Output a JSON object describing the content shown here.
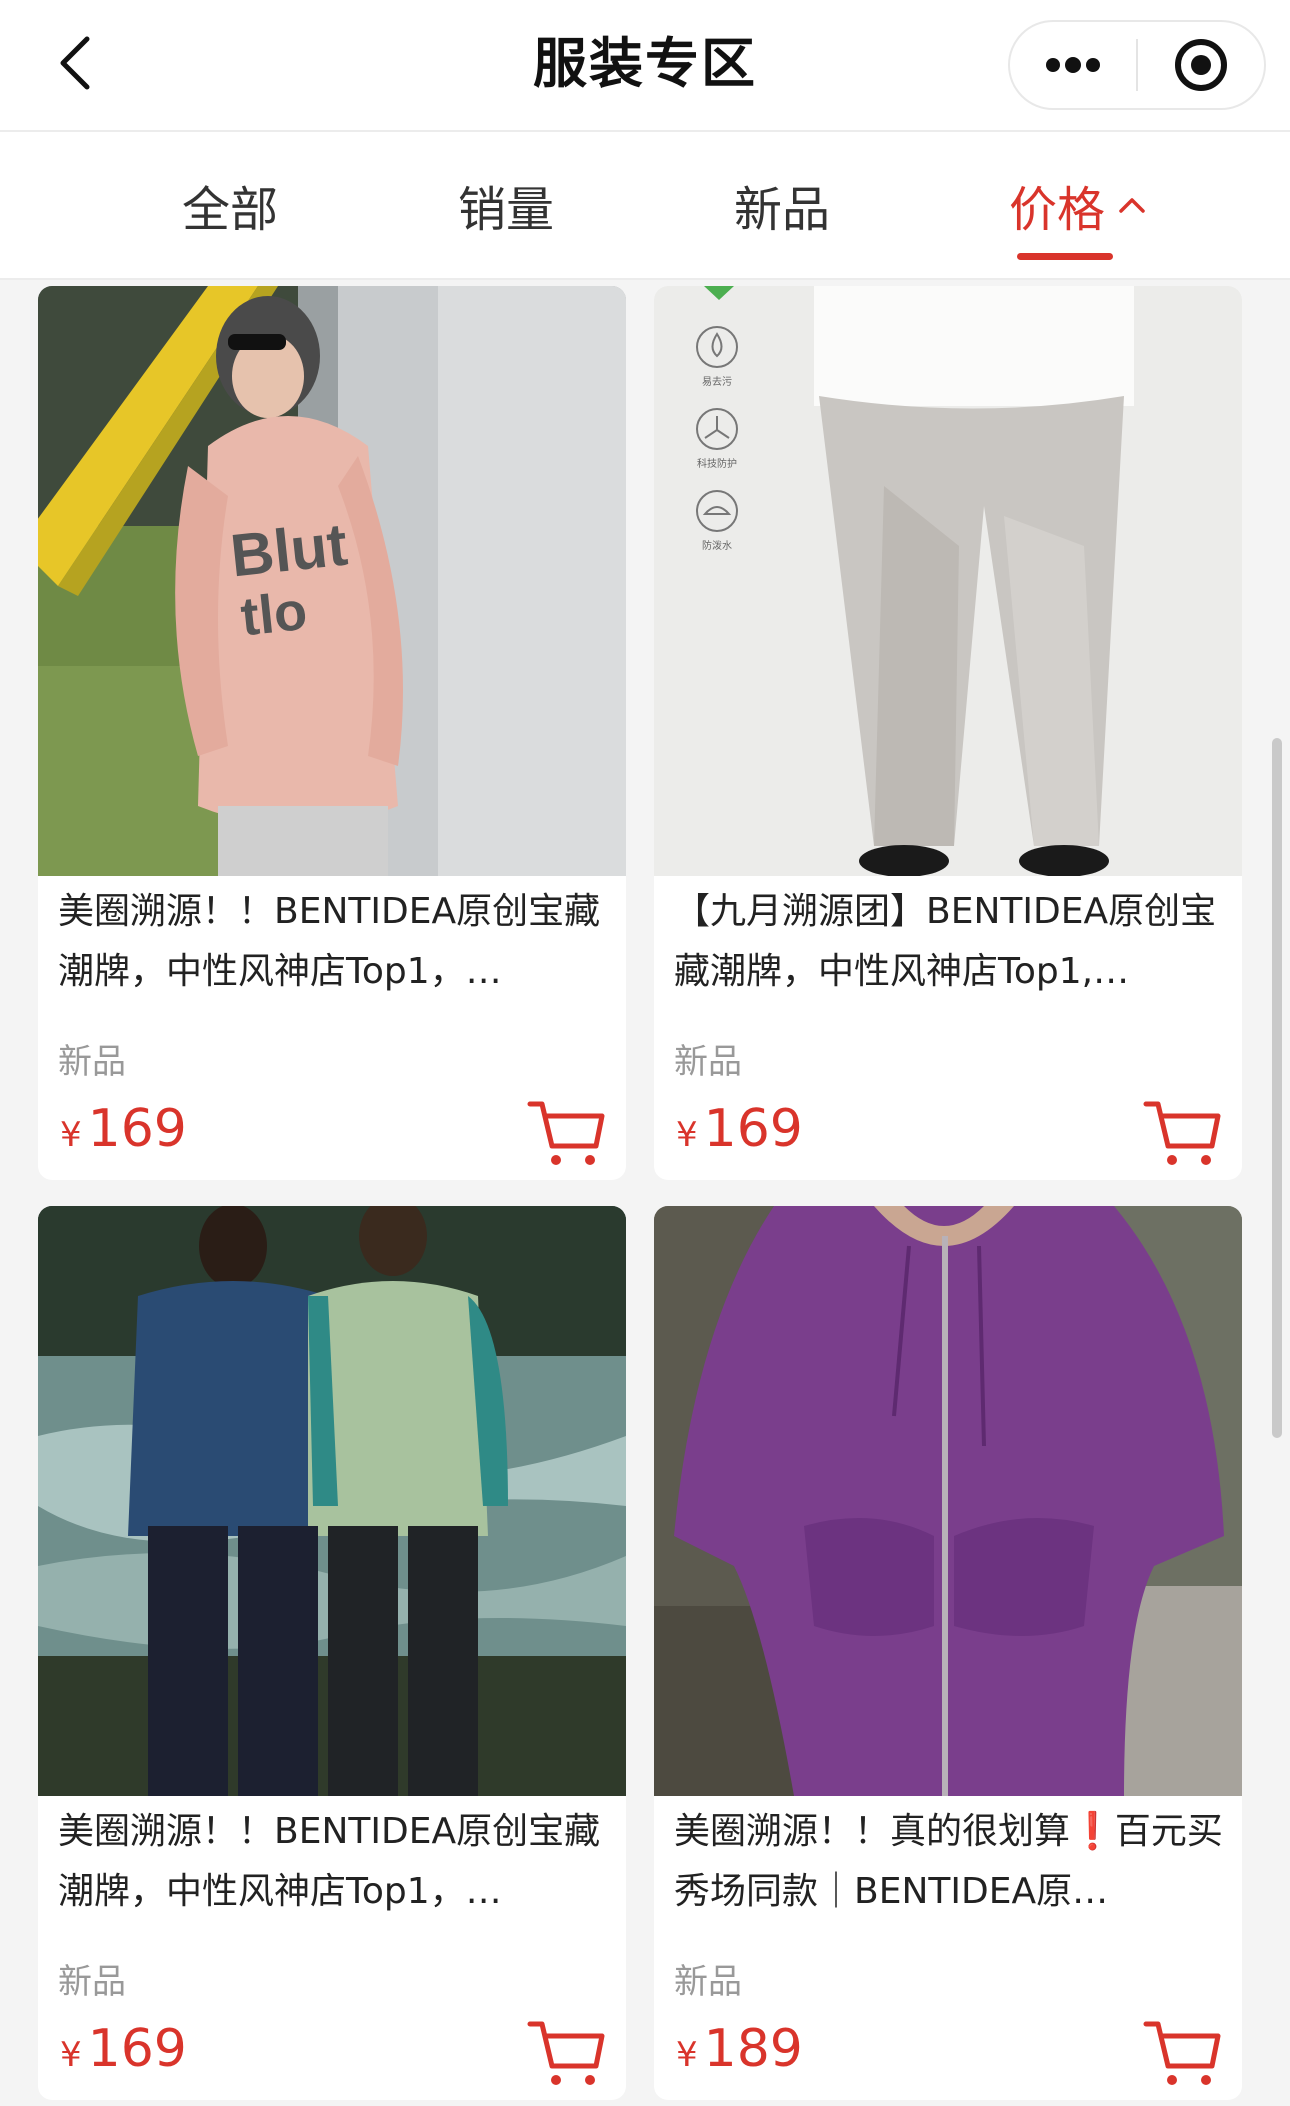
{
  "nav": {
    "title": "服装专区",
    "back_icon": "chevron-left-icon",
    "more_icon": "more-dots-icon",
    "close_icon": "target-circle-icon"
  },
  "tabs": [
    {
      "label": "全部",
      "active": false
    },
    {
      "label": "销量",
      "active": false
    },
    {
      "label": "新品",
      "active": false
    },
    {
      "label": "价格",
      "active": true,
      "icon": "chevron-up-icon"
    }
  ],
  "products": [
    {
      "name": "美圈溯源！！BENTIDEA原创宝藏潮牌，中性风神店Top1，…",
      "tag": "新品",
      "currency": "¥",
      "price": "169",
      "image": "pink-hoodie-photo",
      "cart_icon": "cart-icon"
    },
    {
      "name": "【九月溯源团】BENTIDEA原创宝藏潮牌，中性风神店Top1,…",
      "tag": "新品",
      "currency": "¥",
      "price": "169",
      "image": "grey-pants-photo",
      "badges": [
        "易去污",
        "科技防护",
        "防泼水"
      ],
      "cart_icon": "cart-icon"
    },
    {
      "name": "美圈溯源！！BENTIDEA原创宝藏潮牌，中性风神店Top1，…",
      "tag": "新品",
      "currency": "¥",
      "price": "169",
      "image": "couple-longsleeve-photo",
      "cart_icon": "cart-icon"
    },
    {
      "name": "美圈溯源！！真的很划算❗百元买秀场同款｜BENTIDEA原…",
      "tag": "新品",
      "currency": "¥",
      "price": "189",
      "image": "purple-zip-hoodie-photo",
      "cart_icon": "cart-icon"
    }
  ],
  "colors": {
    "accent": "#d9342b",
    "background": "#f4f4f4",
    "card": "#ffffff",
    "muted_text": "#999999"
  }
}
